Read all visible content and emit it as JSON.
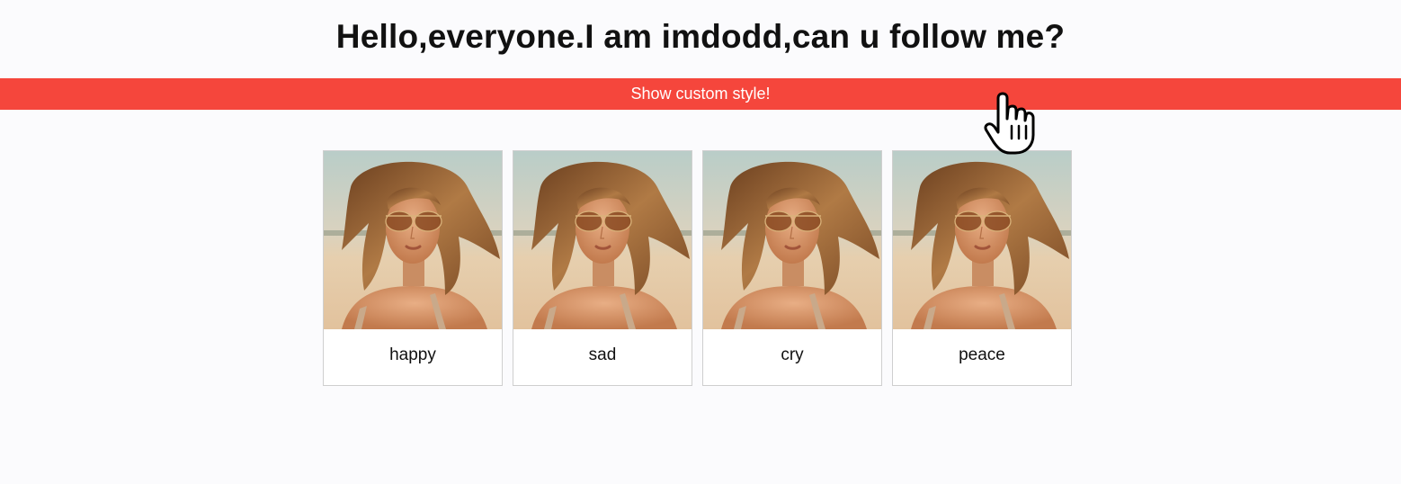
{
  "header": {
    "title": "Hello,everyone.I am imdodd,can u follow me?"
  },
  "banner": {
    "label": "Show custom style!",
    "color": "#f5463c"
  },
  "cards": [
    {
      "caption": "happy"
    },
    {
      "caption": "sad"
    },
    {
      "caption": "cry"
    },
    {
      "caption": "peace"
    }
  ],
  "cursor": {
    "icon": "hand-pointer-icon"
  }
}
